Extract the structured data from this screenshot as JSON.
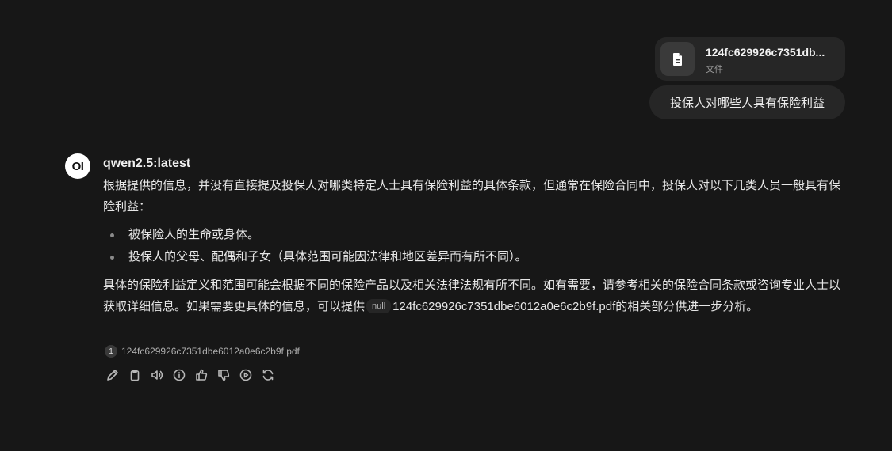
{
  "user": {
    "file": {
      "name": "124fc629926c7351db...",
      "type_label": "文件",
      "icon": "document-icon"
    },
    "message": "投保人对哪些人具有保险利益"
  },
  "assistant": {
    "avatar_text": "OI",
    "model_name": "qwen2.5:latest",
    "intro": "根据提供的信息，并没有直接提及投保人对哪类特定人士具有保险利益的具体条款，但通常在保险合同中，投保人对以下几类人员一般具有保险利益：",
    "bullets": [
      "被保险人的生命或身体。",
      "投保人的父母、配偶和子女（具体范围可能因法律和地区差异而有所不同）。"
    ],
    "para2_before": "具体的保险利益定义和范围可能会根据不同的保险产品以及相关法律法规有所不同。如有需要，请参考相关的保险合同条款或咨询专业人士以获取详细信息。如果需要更具体的信息，可以提供",
    "null_chip": "null",
    "para2_after": "124fc629926c7351dbe6012a0e6c2b9f.pdf的相关部分供进一步分析。",
    "citation": {
      "number": "1",
      "source": "124fc629926c7351dbe6012a0e6c2b9f.pdf"
    },
    "actions": [
      "edit-icon",
      "copy-icon",
      "read-aloud-icon",
      "info-icon",
      "thumbs-up-icon",
      "thumbs-down-icon",
      "continue-icon",
      "regenerate-icon"
    ]
  },
  "colors": {
    "background": "#171717",
    "bubble": "#262626",
    "text": "#ececec",
    "muted": "#9a9a9a"
  }
}
